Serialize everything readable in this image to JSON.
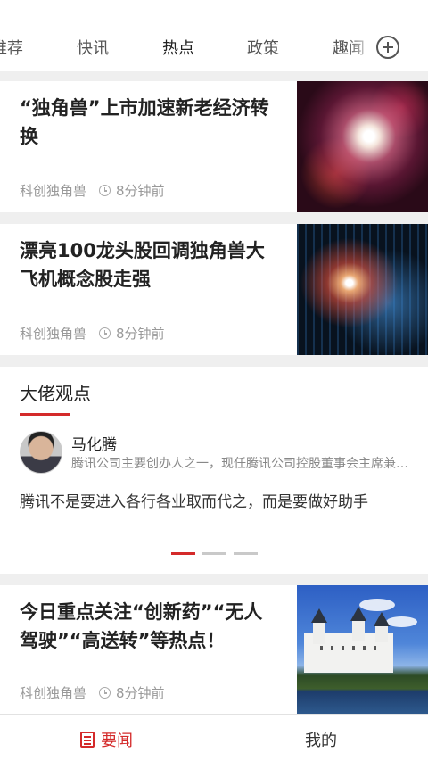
{
  "tabs": [
    {
      "label": "推荐"
    },
    {
      "label": "快讯"
    },
    {
      "label": "热点"
    },
    {
      "label": "政策"
    },
    {
      "label": "趣闻"
    }
  ],
  "active_tab": "热点",
  "news": [
    {
      "title": "“独角兽”上市加速新老经济转换",
      "source": "科创独角兽",
      "time": "8分钟前"
    },
    {
      "title": "漂亮100龙头股回调独角兽大飞机概念股走强",
      "source": "科创独角兽",
      "time": "8分钟前"
    },
    {
      "title": "今日重点关注“创新药”“无人驾驶”“高送转”等热点！",
      "source": "科创独角兽",
      "time": "8分钟前"
    }
  ],
  "experts": {
    "title": "大佬观点",
    "name": "马化腾",
    "desc": "腾讯公司主要创办人之一，现任腾讯公司控股董事会主席兼首席执行官",
    "quote": "腾讯不是要进入各行各业取而代之，而是要做好助手",
    "active_page": 1,
    "page_count": 3
  },
  "bottom_nav": {
    "home": "要闻",
    "mine": "我的"
  },
  "colors": {
    "accent": "#d42a2a"
  }
}
